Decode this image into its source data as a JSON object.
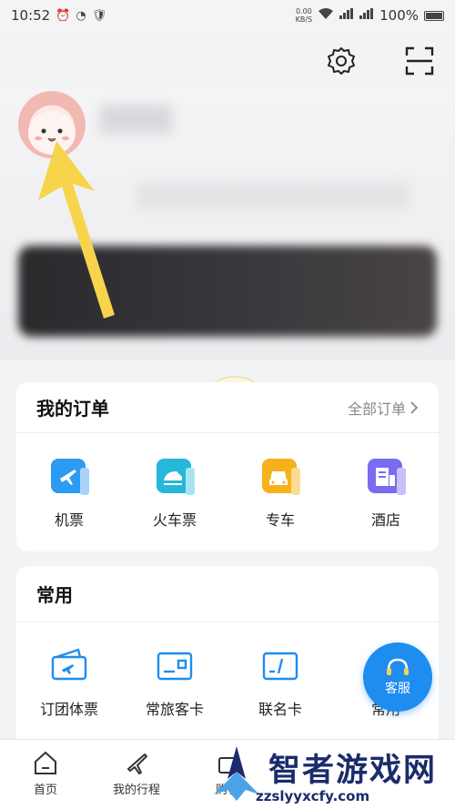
{
  "status_bar": {
    "time": "10:52",
    "speed_value": "0.00",
    "speed_unit": "KB/S",
    "battery": "100%"
  },
  "top_actions": {
    "settings_icon": "gear-icon",
    "scan_icon": "scan-icon"
  },
  "orders": {
    "title": "我的订单",
    "all_link": "全部订单",
    "items": [
      {
        "label": "机票",
        "icon": "plane-ticket-icon",
        "color": "#2b9bf4"
      },
      {
        "label": "火车票",
        "icon": "train-ticket-icon",
        "color": "#25b8d8"
      },
      {
        "label": "专车",
        "icon": "car-icon",
        "color": "#f6b21b"
      },
      {
        "label": "酒店",
        "icon": "hotel-icon",
        "color": "#7a6cf0"
      }
    ]
  },
  "common": {
    "title": "常用",
    "items": [
      {
        "label": "订团体票",
        "icon": "group-ticket-icon"
      },
      {
        "label": "常旅客卡",
        "icon": "frequent-flyer-card-icon"
      },
      {
        "label": "联名卡",
        "icon": "cobrand-card-icon"
      },
      {
        "label": "常用"
      }
    ]
  },
  "service_button": {
    "label": "客服"
  },
  "tabbar": {
    "items": [
      {
        "label": "首页"
      },
      {
        "label": "我的行程"
      },
      {
        "label": "购物"
      }
    ]
  },
  "watermark": {
    "title": "智者游戏网",
    "url": "zzslyyxcfy.com"
  },
  "colors": {
    "accent": "#1f8cf0",
    "arrow": "#f7d44c"
  }
}
